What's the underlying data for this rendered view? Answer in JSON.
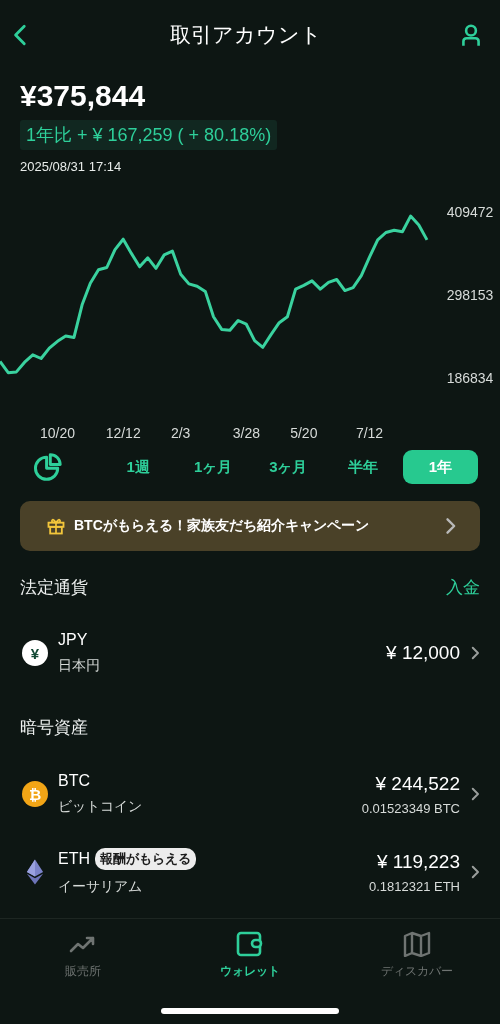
{
  "header": {
    "title": "取引アカウント"
  },
  "balance": {
    "amount": "¥375,844",
    "change": "1年比 + ¥ 167,259 ( + 80.18%)",
    "timestamp": "2025/08/31 17:14"
  },
  "chart": {
    "chart_data": {
      "type": "line",
      "ylim": [
        186834,
        409472
      ],
      "categories": [
        null,
        null,
        null,
        null,
        null,
        null,
        null,
        "10/20",
        null,
        null,
        null,
        null,
        null,
        null,
        null,
        "12/12",
        null,
        null,
        null,
        null,
        null,
        null,
        "2/3",
        null,
        null,
        null,
        null,
        null,
        null,
        null,
        "3/28",
        null,
        null,
        null,
        null,
        null,
        null,
        "5/20",
        null,
        null,
        null,
        null,
        null,
        null,
        null,
        "7/12",
        null,
        null,
        null,
        null,
        null,
        null,
        null
      ],
      "series": [
        {
          "color": "#3ad29f",
          "values": [
            209000,
            194000,
            195000,
            208000,
            218000,
            213000,
            227000,
            236000,
            243000,
            241000,
            285000,
            314000,
            332000,
            335000,
            359000,
            373000,
            354000,
            336000,
            348000,
            334000,
            352000,
            357000,
            326000,
            313000,
            310000,
            303000,
            269000,
            252000,
            251000,
            264000,
            259000,
            237000,
            228000,
            245000,
            261000,
            269000,
            306000,
            311000,
            317000,
            306000,
            315000,
            319000,
            304000,
            308000,
            324000,
            349000,
            372000,
            382000,
            385000,
            383000,
            404000,
            392000,
            372000
          ]
        }
      ],
      "yticks": [
        186834,
        298153,
        409472
      ]
    }
  },
  "periods": [
    {
      "label": "1週",
      "selected": false
    },
    {
      "label": "1ヶ月",
      "selected": false
    },
    {
      "label": "3ヶ月",
      "selected": false
    },
    {
      "label": "半年",
      "selected": false
    },
    {
      "label": "1年",
      "selected": true
    }
  ],
  "banner": {
    "text": "BTCがもらえる！家族友だち紹介キャンペーン"
  },
  "fiat": {
    "title": "法定通貨",
    "action": "入金",
    "items": [
      {
        "kind": "jpy",
        "symbol": "¥",
        "code": "JPY",
        "name": "日本円",
        "value": "¥ 12,000"
      }
    ]
  },
  "crypto": {
    "title": "暗号資産",
    "items": [
      {
        "kind": "btc",
        "symbol": "₿",
        "code": "BTC",
        "name": "ビットコイン",
        "value": "¥ 244,522",
        "quantity": "0.01523349 BTC"
      },
      {
        "kind": "eth",
        "code": "ETH",
        "badge": "報酬がもらえる",
        "name": "イーサリアム",
        "value": "¥ 119,223",
        "quantity": "0.1812321 ETH"
      }
    ]
  },
  "nav": [
    {
      "kind": "chart",
      "label": "販売所",
      "selected": false
    },
    {
      "kind": "wallet",
      "label": "ウォレット",
      "selected": true
    },
    {
      "kind": "map",
      "label": "ディスカバー",
      "selected": false
    }
  ]
}
